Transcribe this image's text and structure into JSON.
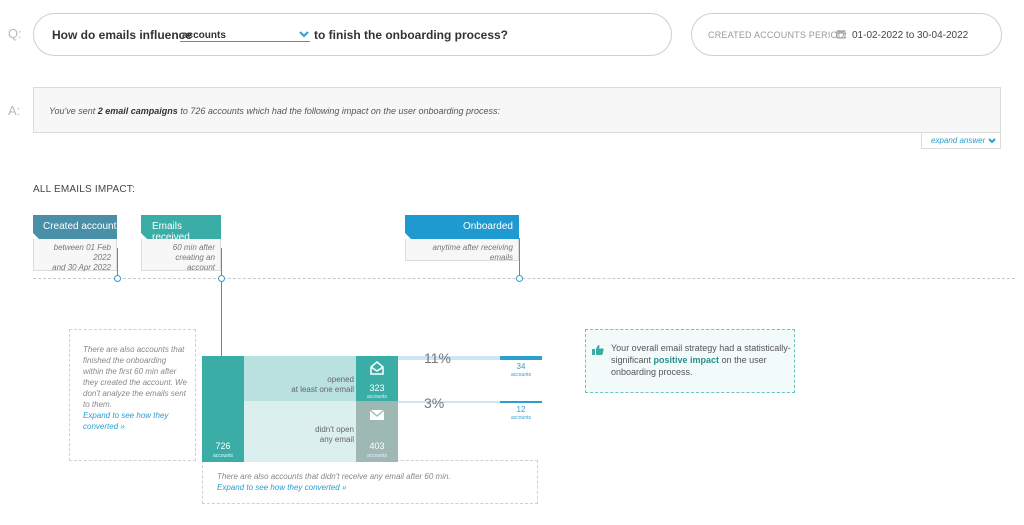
{
  "question": {
    "marker": "Q:",
    "prefix": "How do emails influence",
    "select_value": "accounts",
    "suffix": "to finish the onboarding process?"
  },
  "period": {
    "label": "CREATED ACCOUNTS PERIOD:",
    "value": "01-02-2022 to 30-04-2022"
  },
  "answer": {
    "marker": "A:",
    "text_1": "You've sent ",
    "text_bold": "2 email campaigns",
    "text_2": " to 726 accounts which had the following impact on the user onboarding process:",
    "expand_label": "expand answer"
  },
  "impact_title": "ALL EMAILS IMPACT:",
  "flags": {
    "created": {
      "title": "Created account",
      "sub1": "between 01 Feb 2022",
      "sub2": "and 30 Apr 2022"
    },
    "received": {
      "title": "Emails received",
      "sub1": "60 min after",
      "sub2": "creating an account"
    },
    "onboarded": {
      "title": "Onboarded",
      "sub1": "anytime after receiving emails"
    }
  },
  "left_note": {
    "text": "There are also accounts that finished the onboarding within the first 60 min after they created the account. We don't analyze the emails sent to them.",
    "link": "Expand to see how they converted »"
  },
  "bottom_note": {
    "text": "There are also accounts that didn't receive any email after 60 min.",
    "link": "Expand to see how they converted »"
  },
  "flow": {
    "total": {
      "value": "726",
      "unit": "accounts"
    },
    "opened": {
      "label1": "opened",
      "label2": "at least one email",
      "value": "323",
      "unit": "accounts",
      "pct": "11%",
      "conv": "34",
      "conv_unit": "accounts"
    },
    "not_opened": {
      "label1": "didn't open",
      "label2": "any email",
      "value": "403",
      "unit": "accounts",
      "pct": "3%",
      "conv": "12",
      "conv_unit": "accounts"
    }
  },
  "impact": {
    "text_1": "Your overall email strategy had a statistically-significant ",
    "text_bold": "positive impact",
    "text_2": " on the user onboarding process."
  },
  "colors": {
    "accent_blue": "#2a9fd0",
    "created_flag": "#4a8fa8",
    "received_flag": "#3bada7",
    "onboarded_flag": "#1f9ad1",
    "teal": "#3bada7",
    "grey_teal": "#9eb8b4"
  }
}
